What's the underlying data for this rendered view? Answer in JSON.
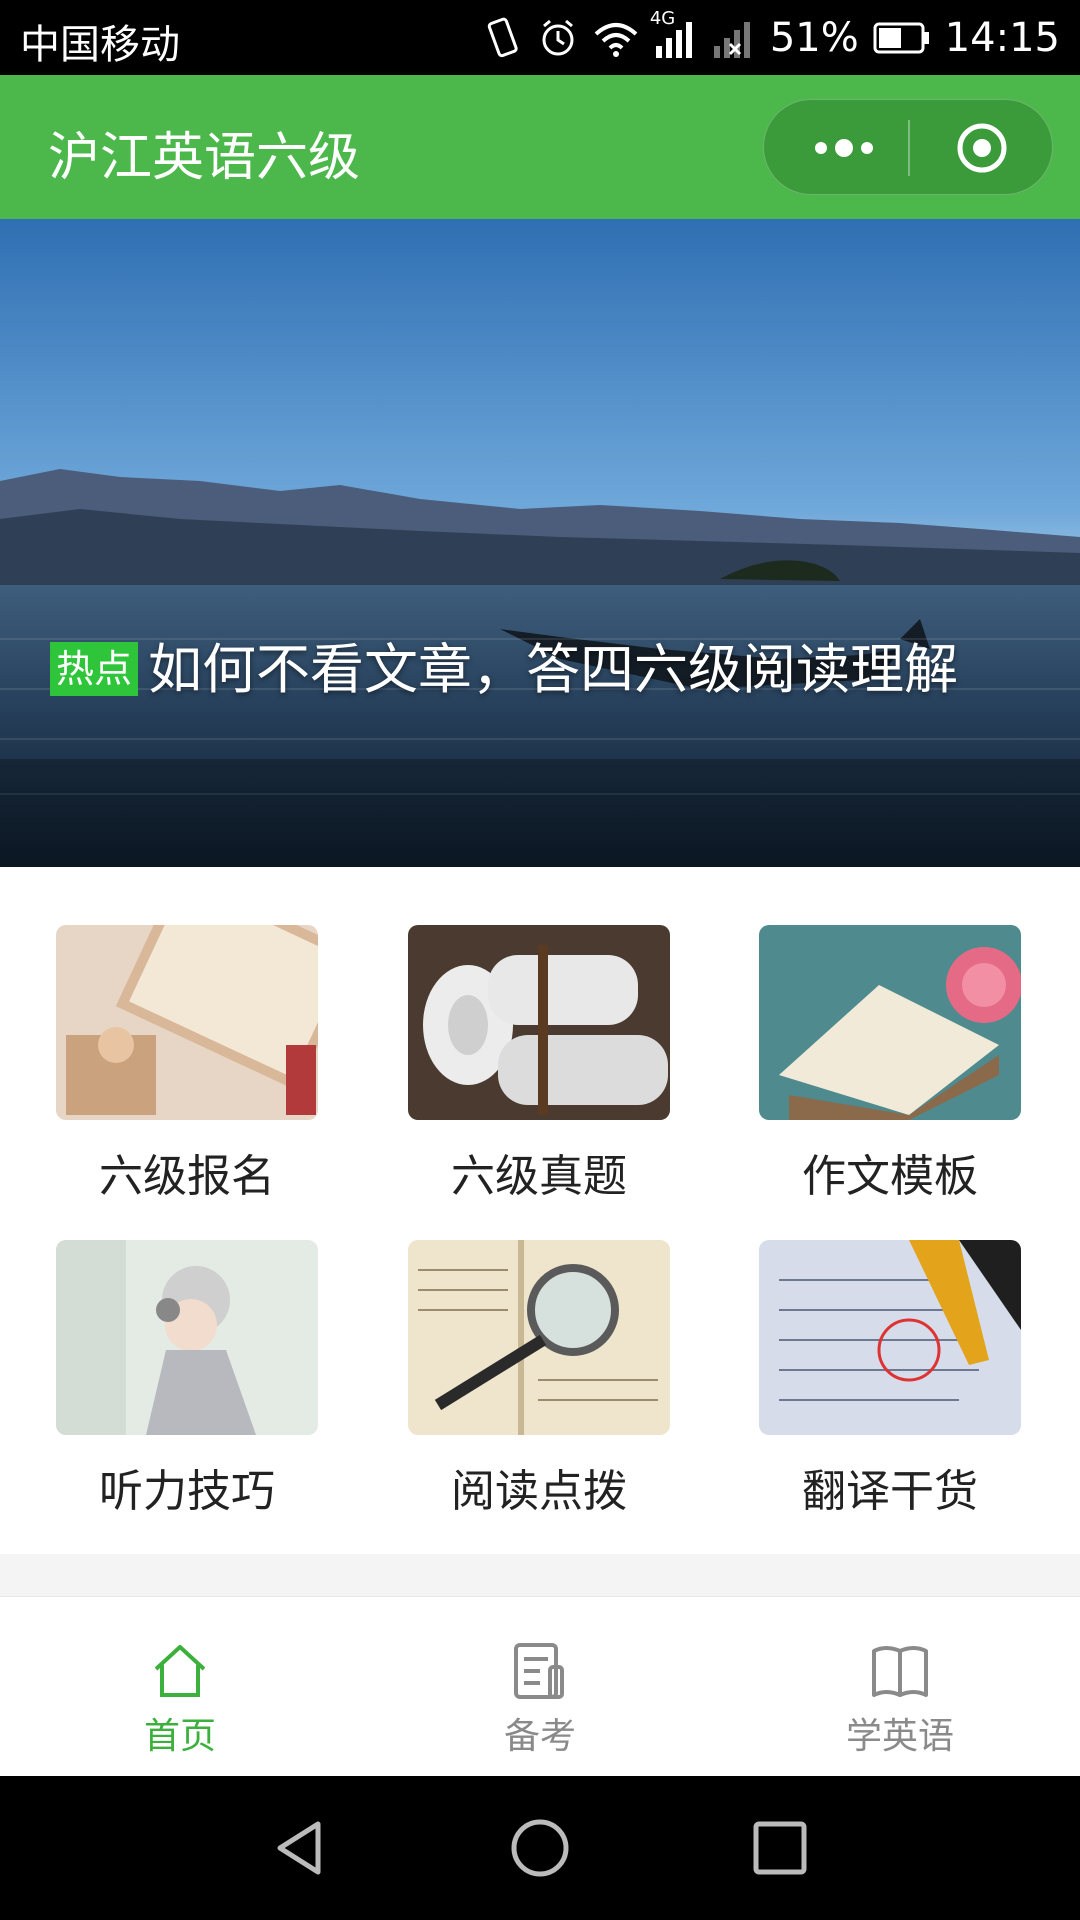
{
  "status_bar": {
    "carrier": "中国移动",
    "battery": "51%",
    "time": "14:15",
    "network": "4G",
    "icons": [
      "vibrate-icon",
      "alarm-icon",
      "wifi-icon",
      "signal-icon",
      "no-signal-icon",
      "battery-icon"
    ]
  },
  "nav": {
    "title": "沪江英语六级",
    "more_icon": "more-dots-icon",
    "close_icon": "target-close-icon",
    "color": "#4cb84c"
  },
  "banner": {
    "tag": "热点",
    "title": "如何不看文章，答四六级阅读理解"
  },
  "grid": {
    "items": [
      {
        "label": "六级报名"
      },
      {
        "label": "六级真题"
      },
      {
        "label": "作文模板"
      },
      {
        "label": "听力技巧"
      },
      {
        "label": "阅读点拨"
      },
      {
        "label": "翻译干货"
      }
    ]
  },
  "tabs": [
    {
      "label": "首页",
      "icon": "home-icon",
      "active": true
    },
    {
      "label": "备考",
      "icon": "notes-icon",
      "active": false
    },
    {
      "label": "学英语",
      "icon": "book-icon",
      "active": false
    }
  ],
  "colors": {
    "accent": "#4cb84c",
    "active_tab": "#3cb03c",
    "inactive_tab": "#8a8a8a"
  },
  "system_nav": [
    "back-icon",
    "home-circle-icon",
    "recents-icon"
  ]
}
